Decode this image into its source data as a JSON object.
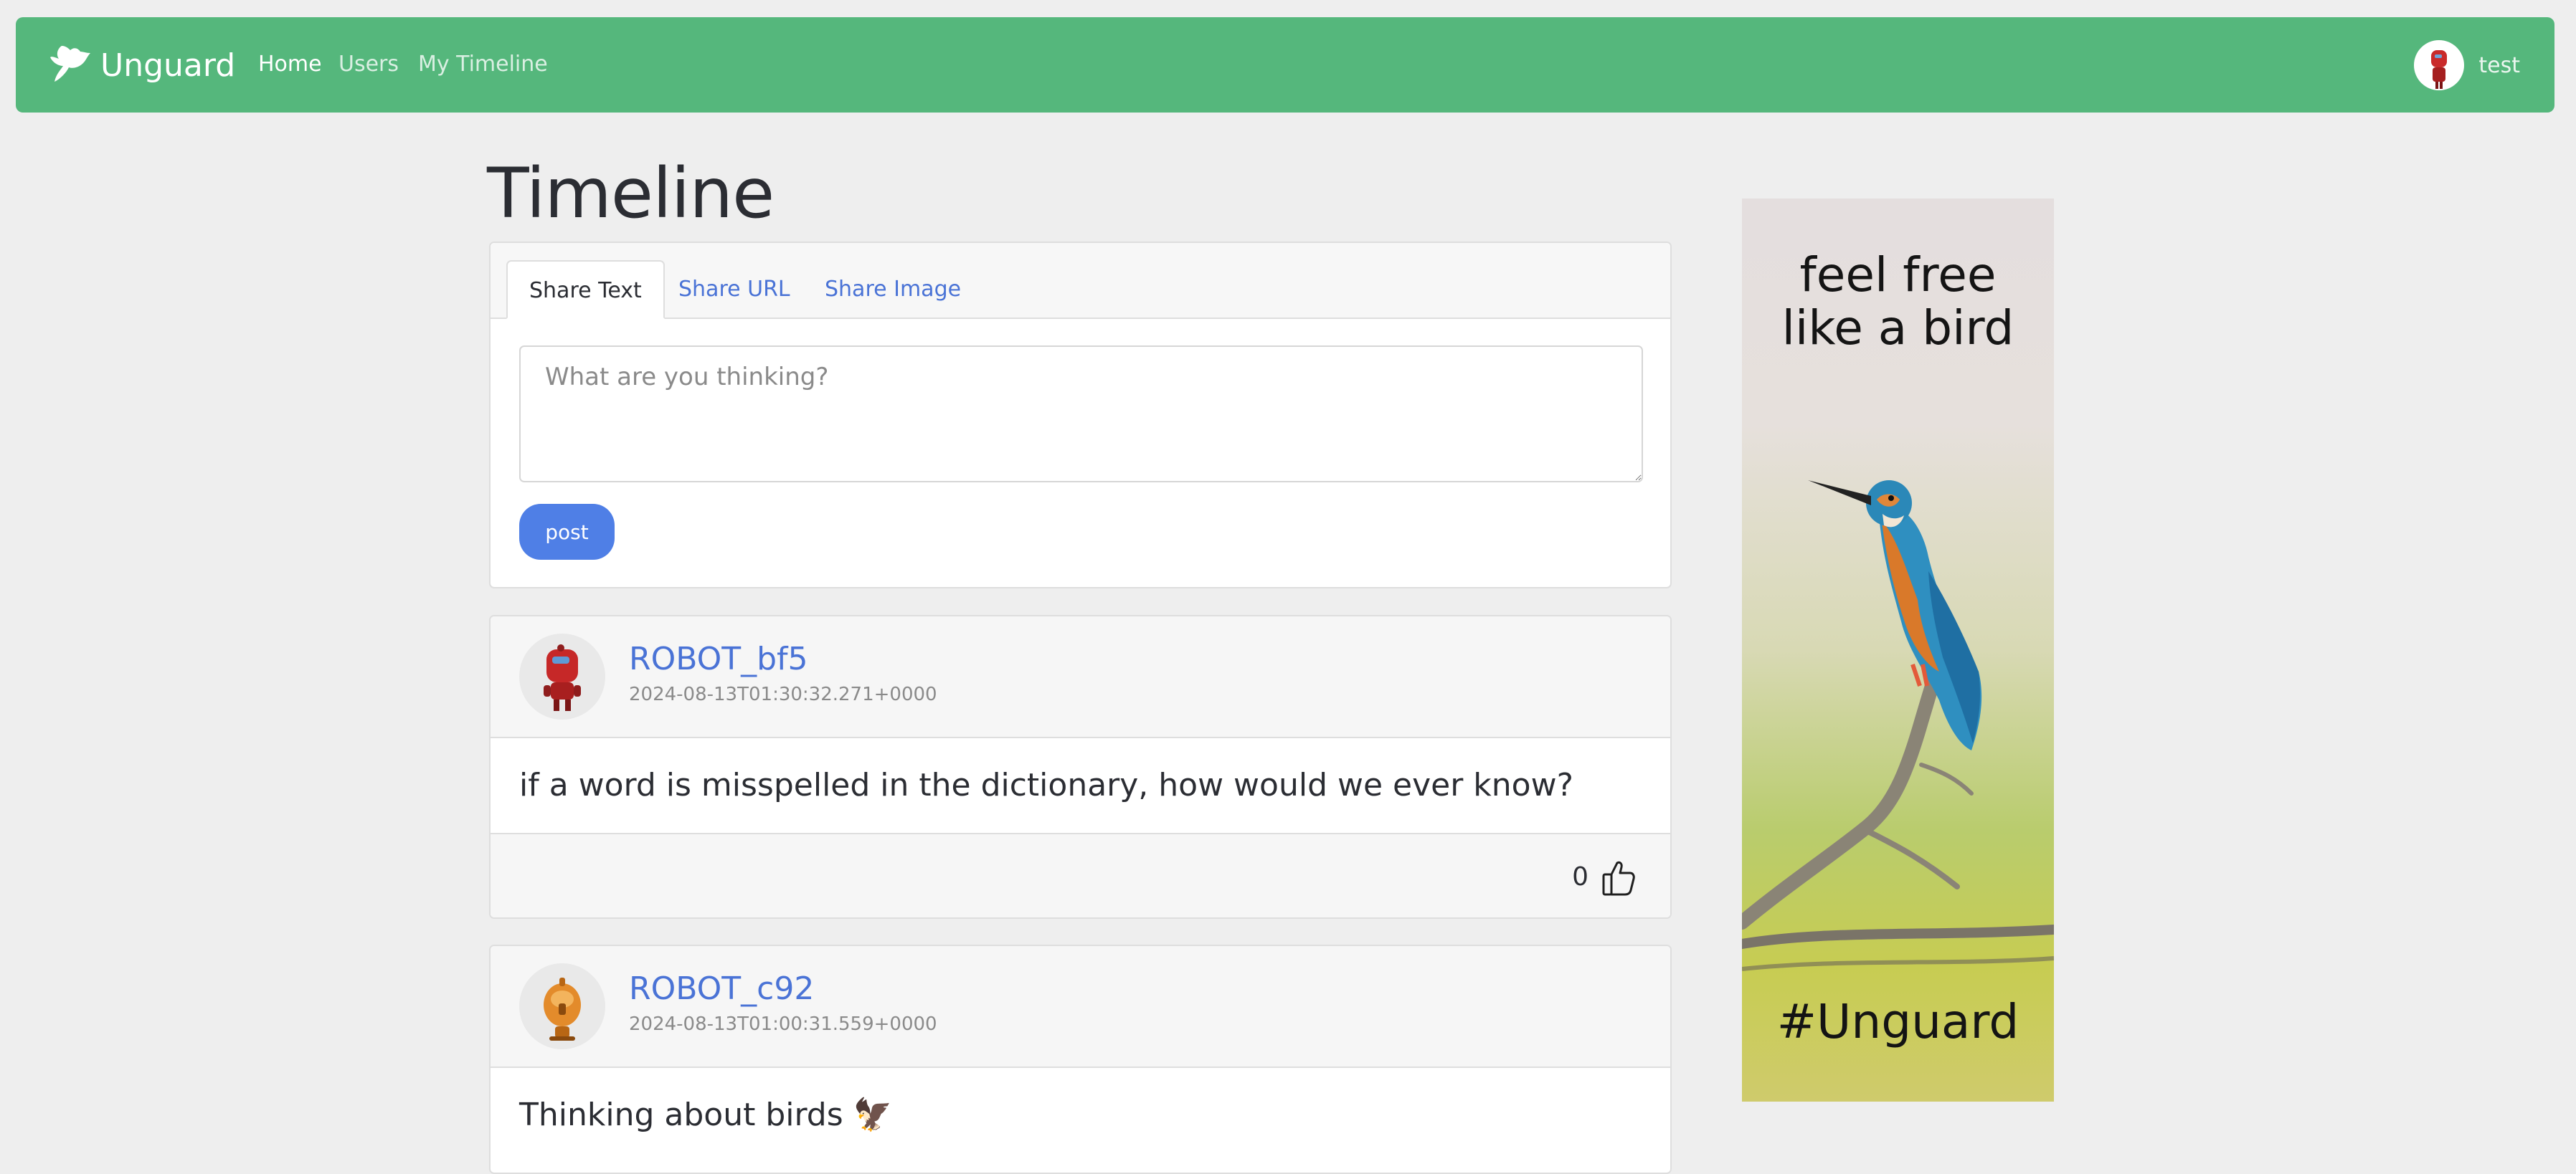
{
  "nav": {
    "brand": "Unguard",
    "links": [
      "Home",
      "Users",
      "My Timeline"
    ],
    "active": "Home",
    "user": "test",
    "brand_color": "#55b77c"
  },
  "page": {
    "title": "Timeline"
  },
  "compose": {
    "tabs": [
      "Share Text",
      "Share URL",
      "Share Image"
    ],
    "active_tab": "Share Text",
    "placeholder": "What are you thinking?",
    "value": "",
    "post_label": "post"
  },
  "posts": [
    {
      "author": "ROBOT_bf5",
      "timestamp": "2024-08-13T01:30:32.271+0000",
      "text": "if a word is misspelled in the dictionary, how would we ever know?",
      "likes": "0",
      "avatar_icon": "red-robot-icon"
    },
    {
      "author": "ROBOT_c92",
      "timestamp": "2024-08-13T01:00:31.559+0000",
      "text": "Thinking about birds 🦅",
      "avatar_icon": "orange-robot-icon"
    }
  ],
  "ad": {
    "headline": "feel free\nlike a bird",
    "tag": "#Unguard",
    "image": "kingfisher-on-branch"
  }
}
